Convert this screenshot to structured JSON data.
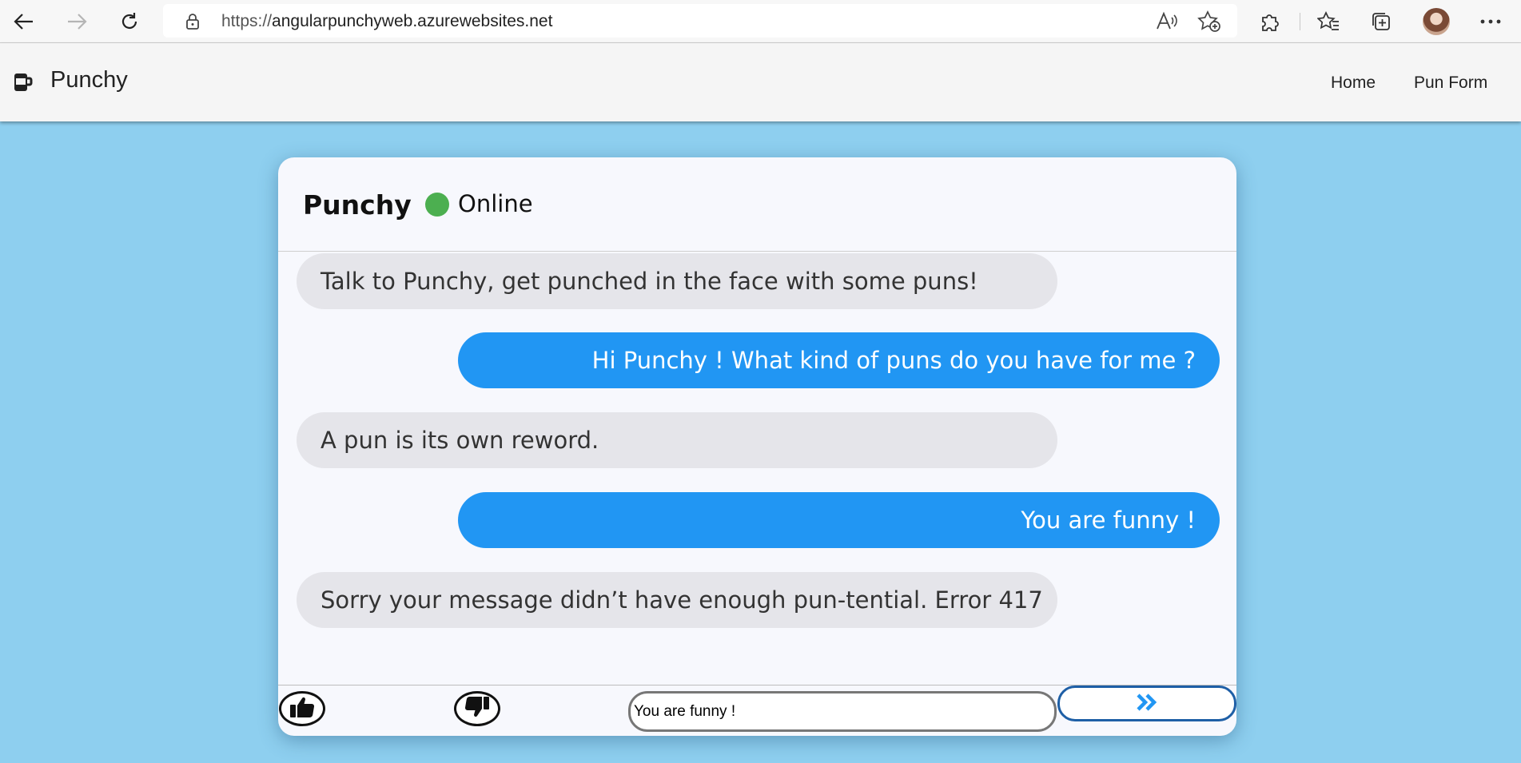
{
  "browser": {
    "url_scheme": "https://",
    "url_host": "angularpunchyweb.azurewebsites.net"
  },
  "app": {
    "brand": "Punchy",
    "nav": [
      {
        "label": "Home"
      },
      {
        "label": "Pun Form"
      }
    ]
  },
  "chat": {
    "bot_name": "Punchy",
    "status": "Online",
    "status_color": "#4caf50",
    "messages": [
      {
        "from": "bot",
        "text": "Talk to Punchy, get punched in the face with some puns!"
      },
      {
        "from": "user",
        "text": "Hi Punchy ! What kind of puns do you have for me ?"
      },
      {
        "from": "bot",
        "text": "A pun is its own reword."
      },
      {
        "from": "user",
        "text": "You are funny !"
      },
      {
        "from": "bot",
        "text": "Sorry your message didn’t have enough pun-tential. Error 417"
      }
    ],
    "input_value": "You are funny !",
    "colors": {
      "user_bubble": "#2196f3",
      "bot_bubble": "#e5e5ea",
      "background": "#8ecfef"
    }
  },
  "icons": {
    "back": "back-arrow-icon",
    "forward": "forward-arrow-icon",
    "refresh": "refresh-icon",
    "lock": "lock-icon",
    "read_aloud": "read-aloud-icon",
    "add_favorite": "add-favorite-icon",
    "extensions": "extensions-icon",
    "favorites": "favorites-icon",
    "collections": "collections-icon",
    "more": "more-icon",
    "brand": "coffee-cup-icon",
    "thumbs_up": "thumbs-up-icon",
    "thumbs_down": "thumbs-down-icon",
    "send": "double-chevron-right-icon"
  }
}
